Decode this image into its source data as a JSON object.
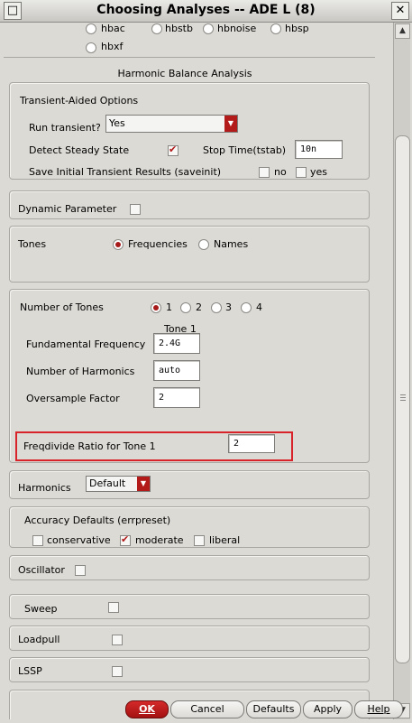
{
  "window": {
    "title": "Choosing Analyses -- ADE L (8)"
  },
  "analysis_types_row1": [
    "hbac",
    "hbstb",
    "hbnoise",
    "hbsp"
  ],
  "analysis_types_row2": [
    "hbxf"
  ],
  "section_title": "Harmonic Balance Analysis",
  "transient": {
    "heading": "Transient-Aided Options",
    "run_label": "Run transient?",
    "run_value": "Yes",
    "steady_label": "Detect Steady State",
    "stop_label": "Stop Time(tstab)",
    "stop_value": "10n",
    "save_label": "Save Initial Transient Results (saveinit)",
    "save_no": "no",
    "save_yes": "yes"
  },
  "dynamic_parameter_label": "Dynamic Parameter",
  "tones": {
    "label": "Tones",
    "opt_frequencies": "Frequencies",
    "opt_names": "Names"
  },
  "num_tones": {
    "label": "Number of Tones",
    "options": [
      "1",
      "2",
      "3",
      "4"
    ],
    "col_header": "Tone 1",
    "fund_label": "Fundamental Frequency",
    "fund_value": "2.4G",
    "harm_label": "Number of Harmonics",
    "harm_value": "auto",
    "over_label": "Oversample Factor",
    "over_value": "2",
    "freqdiv_label": "Freqdivide Ratio for Tone 1",
    "freqdiv_value": "2"
  },
  "harmonics": {
    "label": "Harmonics",
    "value": "Default"
  },
  "accuracy": {
    "label": "Accuracy Defaults (errpreset)",
    "conservative": "conservative",
    "moderate": "moderate",
    "liberal": "liberal"
  },
  "oscillator_label": "Oscillator",
  "sweep_label": "Sweep",
  "loadpull_label": "Loadpull",
  "lssp_label": "LSSP",
  "buttons": {
    "ok": "OK",
    "cancel": "Cancel",
    "defaults": "Defaults",
    "apply": "Apply",
    "help": "Help"
  },
  "colors": {
    "accent": "#b31b1b",
    "highlight": "#d9232a",
    "background": "#dcdad5"
  }
}
